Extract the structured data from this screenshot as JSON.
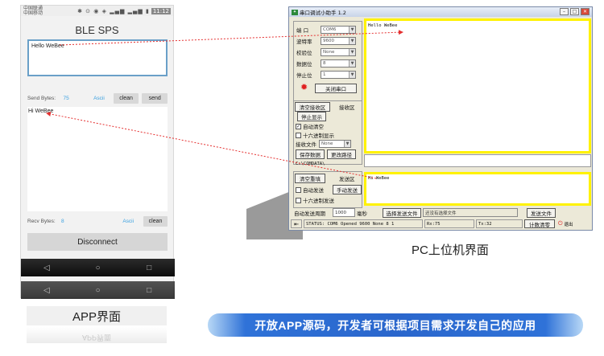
{
  "phone": {
    "status": {
      "carrier1": "中国联通",
      "carrier2": "中国移动",
      "signals": "✱ ⊙ ◉ ◈ ▂▄▆ ▂▄▆ ▮",
      "time": "11:12"
    },
    "title": "BLE SPS",
    "received_text": "Hello WeBee",
    "send_bytes_label": "Send Bytes:",
    "send_bytes_value": "75",
    "ascii_label": "Ascii",
    "clean_label": "clean",
    "send_label": "send",
    "send_text": "Hi WeBee",
    "recv_bytes_label": "Recv Bytes:",
    "recv_bytes_value": "8",
    "disconnect_label": "Disconnect",
    "nav": {
      "back": "◁",
      "home": "○",
      "recent": "□"
    }
  },
  "app_caption": "APP界面",
  "app_caption_reflection": "APP界面",
  "pc": {
    "window_title": "串口调试小助手 1.2",
    "settings": [
      {
        "label": "端  口",
        "value": "COM6"
      },
      {
        "label": "波特率",
        "value": "9600"
      },
      {
        "label": "校验位",
        "value": "None"
      },
      {
        "label": "数据位",
        "value": "8"
      },
      {
        "label": "停止位",
        "value": "1"
      }
    ],
    "close_port_label": "关闭串口",
    "clear_recv_label": "清空接收区",
    "recv_area_label": "接收区",
    "stop_display_label": "停止显示",
    "auto_clear_label": "自动清空",
    "hex_display_label": "十六进制显示",
    "recv_file_label": "接收文件",
    "recv_file_value": "None",
    "save_data_label": "保存数据",
    "change_path_label": "更改路径",
    "path_value": "C:\\COMDATA\\",
    "received_text": "Hello WeBee",
    "clear_resend_label": "清空重填",
    "send_area_label": "发送区",
    "auto_send_label": "自动发送",
    "manual_send_label": "手动发送",
    "hex_send_label": "十六进制发送",
    "send_text": "Hi WeBee",
    "auto_period_label": "自动发送周期",
    "auto_period_value": "1000",
    "ms_label": "毫秒",
    "select_file_label": "选择发送文件",
    "no_file_label": "还没有选择文件",
    "send_file_label": "发送文件",
    "status_text": "STATUS: COM6 Opened 9600 None 8 1",
    "rx_text": "Rx:75",
    "tx_text": "Tx:32",
    "reset_count_label": "计数清零",
    "exit_label": "退出"
  },
  "pc_caption": "PC上位机界面",
  "banner_text": "开放APP源码，开发者可根据项目需求开发自己的应用",
  "colors": {
    "highlight": "#fff200",
    "arrow": "#e53030",
    "banner": "#2a66cc",
    "accent": "#3aa0e0"
  }
}
